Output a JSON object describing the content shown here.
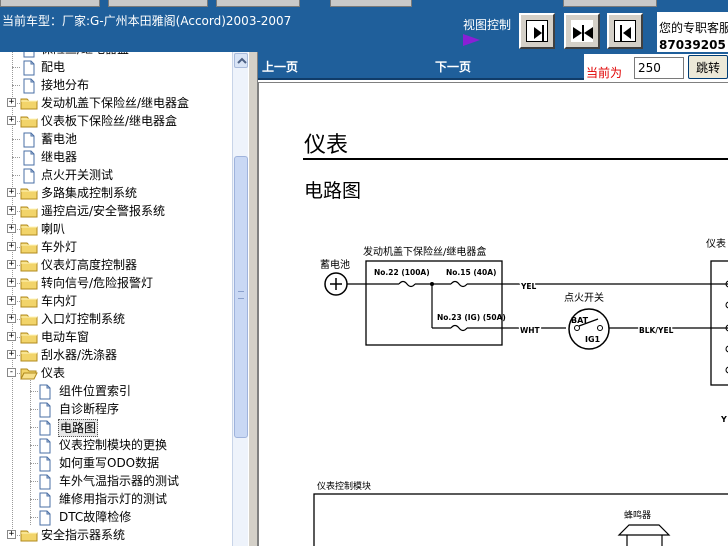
{
  "header": {
    "car_model": "当前车型：厂家:G-广州本田雅阁(Accord)2003-2007",
    "view_control_label": "视图控制",
    "contact_label": "您的专职客服",
    "contact_phone": "87039205"
  },
  "tree": {
    "items": [
      {
        "label": "保险丝/继电器盒"
      },
      {
        "label": "配电"
      },
      {
        "label": "接地分布"
      },
      {
        "label": "发动机盖下保险丝/继电器盒"
      },
      {
        "label": "仪表板下保险丝/继电器盒"
      },
      {
        "label": "蓄电池"
      },
      {
        "label": "继电器"
      },
      {
        "label": "点火开关测试"
      },
      {
        "label": "多路集成控制系统"
      },
      {
        "label": "遥控启远/安全警报系统"
      },
      {
        "label": "喇叭"
      },
      {
        "label": "车外灯"
      },
      {
        "label": "仪表灯高度控制器"
      },
      {
        "label": "转向信号/危险报警灯"
      },
      {
        "label": "车内灯"
      },
      {
        "label": "入口灯控制系统"
      },
      {
        "label": "电动车窗"
      },
      {
        "label": "刮水器/洗涤器"
      },
      {
        "label": "仪表"
      },
      {
        "label": "组件位置索引"
      },
      {
        "label": "自诊断程序"
      },
      {
        "label": "电路图"
      },
      {
        "label": "仪表控制模块的更换"
      },
      {
        "label": "如何重写ODO数据"
      },
      {
        "label": "车外气温指示器的测试"
      },
      {
        "label": "維修用指示灯的测试"
      },
      {
        "label": "DTC故障检修"
      },
      {
        "label": "安全指示器系统"
      }
    ]
  },
  "nav": {
    "prev": "上一页",
    "next": "下一页",
    "current_label": "当前为",
    "page_value": "250",
    "jump_button": "跳转"
  },
  "document": {
    "title": "仪表",
    "subtitle": "电路图",
    "diagram": {
      "fuse_box_label": "发动机盖下保险丝/继电器盒",
      "battery_label": "蓄电池",
      "fuse1": "No.22 (100A)",
      "fuse2": "No.15 (40A)",
      "fuse3": "No.23 (IG) (50A)",
      "wire_yel": "YEL",
      "wire_wht": "WHT",
      "ignition_label": "点火开关",
      "bat_label": "BAT",
      "ig1_label": "IG1",
      "wire_blk_yel": "BLK/YEL",
      "instrument_label": "仪表",
      "module_label": "仪表控制模块",
      "buzzer_label": "蜂鸣器",
      "right_partial": "Y"
    }
  },
  "colors": {
    "header_bg": "#1f5f9b",
    "arrow": "#8a1fd6",
    "current_label": "#e00000",
    "folder": "#f2d46a"
  }
}
